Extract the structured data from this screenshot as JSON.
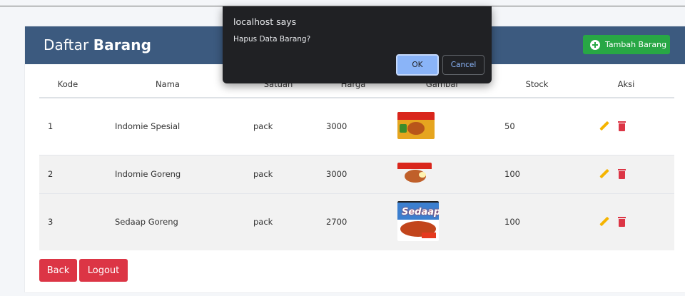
{
  "card": {
    "title_light": "Daftar",
    "title_bold": "Barang",
    "add_button": "Tambah Barang"
  },
  "table": {
    "headers": [
      "Kode",
      "Nama",
      "Satuan",
      "Harga",
      "Gambar",
      "Stock",
      "Aksi"
    ],
    "rows": [
      {
        "kode": "1",
        "nama": "Indomie Spesial",
        "satuan": "pack",
        "harga": "3000",
        "stock": "50"
      },
      {
        "kode": "2",
        "nama": "Indomie Goreng",
        "satuan": "pack",
        "harga": "3000",
        "stock": "100"
      },
      {
        "kode": "3",
        "nama": "Sedaap Goreng",
        "satuan": "pack",
        "harga": "2700",
        "stock": "100"
      }
    ]
  },
  "image_logo": "Sedaap",
  "footer": {
    "back_button": "Back",
    "logout_button": "Logout"
  },
  "dialog": {
    "title": "localhost says",
    "message": "Hapus Data Barang?",
    "ok": "OK",
    "cancel": "Cancel"
  },
  "colors": {
    "header": "#3c5a7f",
    "add_button": "#28a745",
    "danger": "#dc3545",
    "edit_icon": "#f5b400",
    "dialog_bg": "#202124",
    "dialog_ok": "#8ab4f8"
  },
  "icons": [
    "plus-circle-icon",
    "edit-icon",
    "trash-icon"
  ]
}
